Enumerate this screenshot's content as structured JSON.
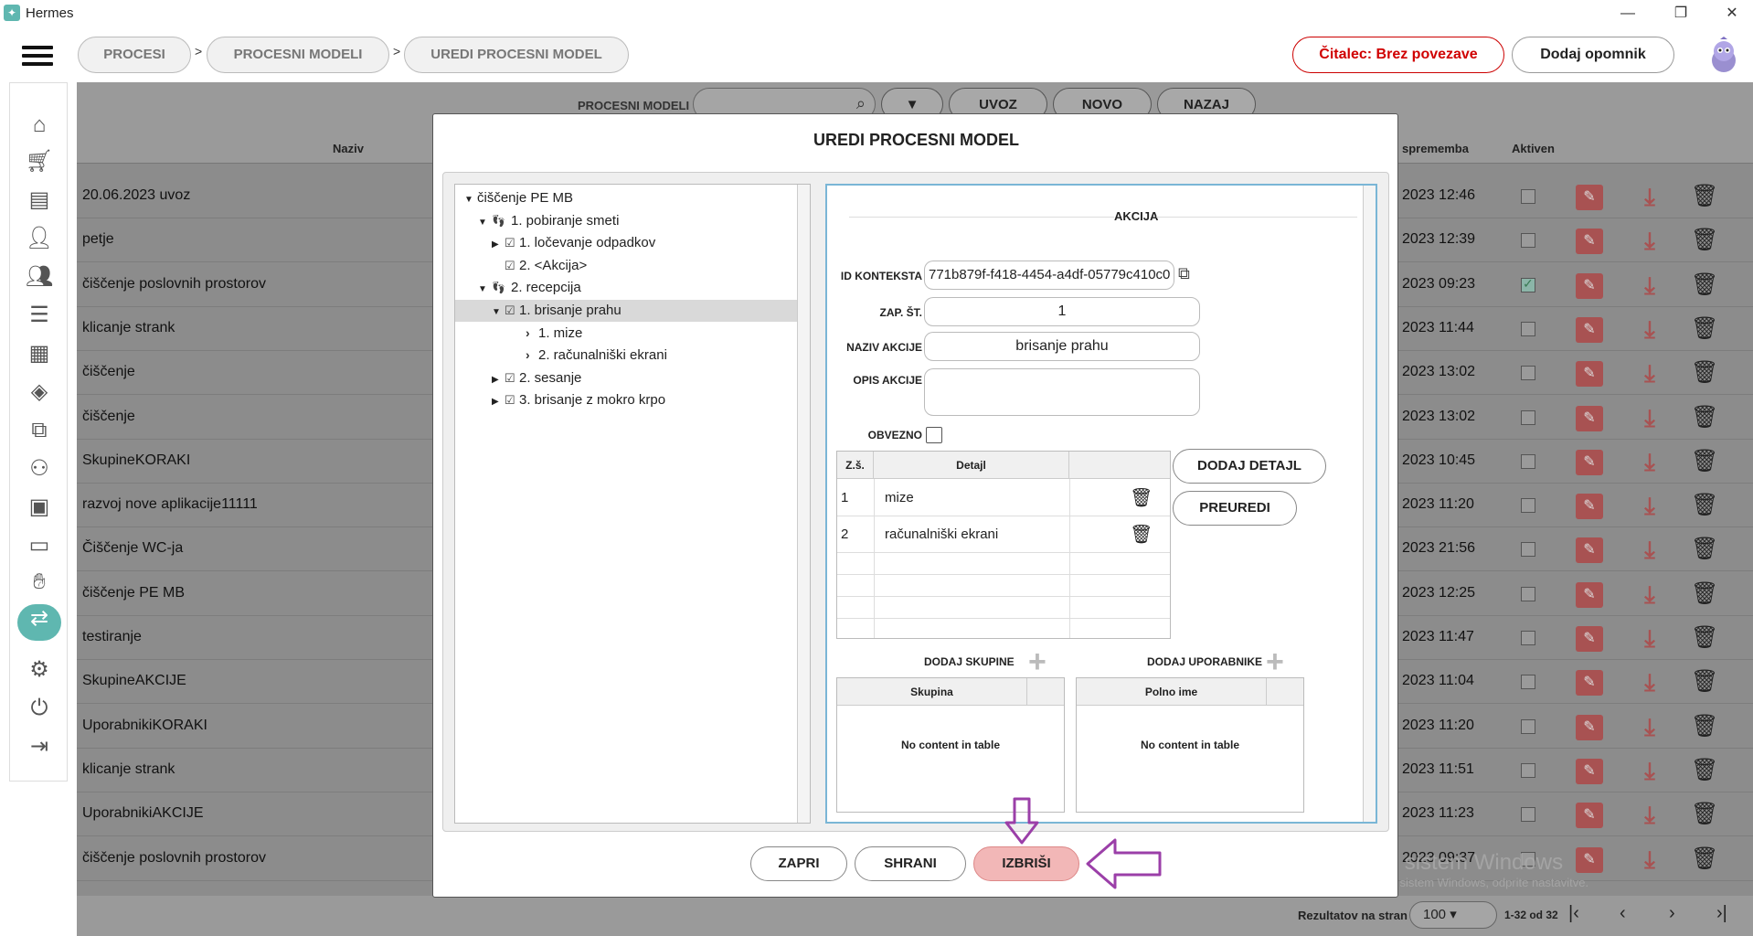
{
  "app": {
    "title": "Hermes"
  },
  "window": {
    "minimize": "—",
    "maximize": "❐",
    "close": "✕"
  },
  "breadcrumb": [
    "PROCESI",
    "PROCESNI MODELI",
    "UREDI PROCESNI MODEL"
  ],
  "breadcrumb_sep": ">",
  "header_buttons": {
    "reader": "Čitalec: Brez povezave",
    "reminder": "Dodaj opomnik"
  },
  "subbar": {
    "label": "PROCESNI MODELI",
    "buttons": [
      "UVOZ",
      "NOVO",
      "NAZAJ"
    ]
  },
  "table": {
    "headers": {
      "name": "Naziv",
      "change": "sprememba",
      "active": "Aktiven"
    },
    "rows": [
      {
        "name": "20.06.2023 uvoz",
        "date": "2023 12:46",
        "active": false
      },
      {
        "name": "petje",
        "date": "2023 12:39",
        "active": false
      },
      {
        "name": "čiščenje poslovnih prostorov",
        "date": "2023 09:23",
        "active": true
      },
      {
        "name": "klicanje strank",
        "date": "2023 11:44",
        "active": false
      },
      {
        "name": "čiščenje",
        "date": "2023 13:02",
        "active": false
      },
      {
        "name": "čiščenje",
        "date": "2023 13:02",
        "active": false
      },
      {
        "name": "SkupineKORAKI",
        "date": "2023 10:45",
        "active": false
      },
      {
        "name": "razvoj nove aplikacije11111",
        "date": "2023 11:20",
        "active": false
      },
      {
        "name": "Čiščenje WC-ja",
        "date": "2023 21:56",
        "active": false
      },
      {
        "name": "čiščenje PE MB",
        "date": "2023 12:25",
        "active": false
      },
      {
        "name": "testiranje",
        "date": "2023 11:47",
        "active": false
      },
      {
        "name": "SkupineAKCIJE",
        "date": "2023 11:04",
        "active": false
      },
      {
        "name": "UporabnikiKORAKI",
        "date": "2023 11:20",
        "active": false
      },
      {
        "name": "klicanje strank",
        "date": "2023 11:51",
        "active": false
      },
      {
        "name": "UporabnikiAKCIJE",
        "date": "2023 11:23",
        "active": false
      },
      {
        "name": "čiščenje poslovnih prostorov",
        "date": "2023 09:37",
        "active": false
      }
    ]
  },
  "footer": {
    "per_page_label": "Rezultatov na stran",
    "per_page": "100",
    "range": "1-32 od 32"
  },
  "watermark": {
    "line1": "Aktivirajte sistem Windows",
    "line2": "Če želite aktivirati sistem Windows, odprite nastavitve."
  },
  "modal": {
    "title": "UREDI PROCESNI MODEL",
    "tree": [
      {
        "label": "čiščenje PE MB",
        "level": 0,
        "tri": "▼",
        "icon": ""
      },
      {
        "label": "1. pobiranje smeti",
        "level": 1,
        "tri": "▼",
        "icon": "steps"
      },
      {
        "label": "1. ločevanje odpadkov",
        "level": 2,
        "tri": "▶",
        "icon": "check"
      },
      {
        "label": "2. <Akcija>",
        "level": 2,
        "tri": "",
        "icon": "check"
      },
      {
        "label": "2. recepcija",
        "level": 1,
        "tri": "▼",
        "icon": "steps"
      },
      {
        "label": "1. brisanje prahu",
        "level": 2,
        "tri": "▼",
        "icon": "check",
        "selected": true
      },
      {
        "label": "1. mize",
        "level": 3,
        "tri": "",
        "icon": "chev"
      },
      {
        "label": "2. računalniški ekrani",
        "level": 3,
        "tri": "",
        "icon": "chev"
      },
      {
        "label": "2. sesanje",
        "level": 2,
        "tri": "▶",
        "icon": "check"
      },
      {
        "label": "3.  brisanje z mokro krpo",
        "level": 2,
        "tri": "▶",
        "icon": "check"
      }
    ],
    "form": {
      "section": "AKCIJA",
      "id_label": "ID KONTEKSTA",
      "id_value": "771b879f-f418-4454-a4df-05779c410c0",
      "seq_label": "ZAP. ŠT.",
      "seq_value": "1",
      "name_label": "NAZIV AKCIJE",
      "name_value": "brisanje prahu",
      "desc_label": "OPIS AKCIJE",
      "desc_value": "",
      "required_label": "OBVEZNO",
      "details_headers": {
        "num": "Z.š.",
        "detail": "Detajl"
      },
      "details": [
        {
          "num": "1",
          "text": "mize"
        },
        {
          "num": "2",
          "text": "računalniški ekrani"
        }
      ],
      "add_detail": "DODAJ DETAJL",
      "reorder": "PREUREDI",
      "add_groups": "DODAJ SKUPINE",
      "add_users": "DODAJ UPORABNIKE",
      "groups_header": "Skupina",
      "users_header": "Polno ime",
      "empty": "No content in table"
    },
    "buttons": {
      "close": "ZAPRI",
      "save": "SHRANI",
      "delete": "IZBRIŠI"
    }
  }
}
